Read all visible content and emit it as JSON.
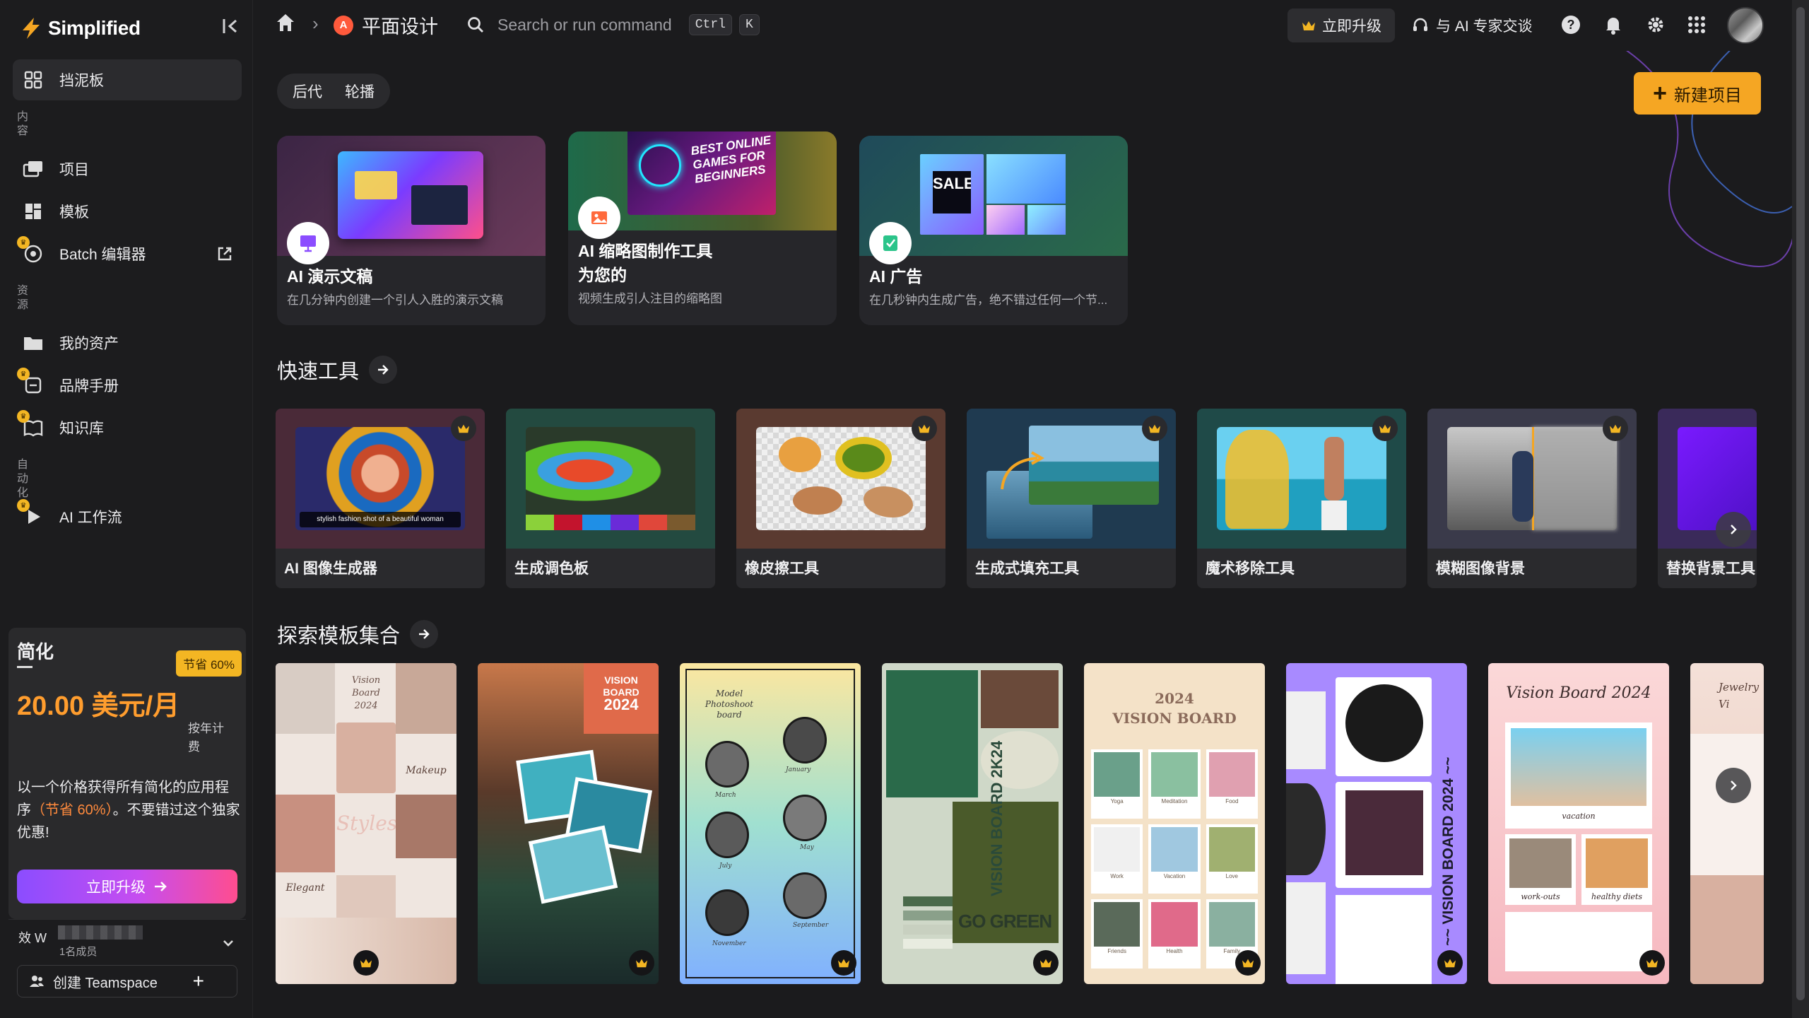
{
  "sidebar": {
    "logo_text": "Simplified",
    "nav": [
      {
        "label": "挡泥板",
        "icon": "dashboard-icon"
      },
      {
        "label": "项目",
        "icon": "projects-icon"
      },
      {
        "label": "模板",
        "icon": "templates-icon"
      },
      {
        "label": "Batch 编辑器",
        "icon": "batch-editor-icon"
      },
      {
        "label": "我的资产",
        "icon": "folder-icon"
      },
      {
        "label": "品牌手册",
        "icon": "brand-kit-icon"
      },
      {
        "label": "知识库",
        "icon": "knowledge-base-icon"
      },
      {
        "label": "AI 工作流",
        "icon": "ai-workflow-icon"
      }
    ],
    "sections": {
      "content": "内容",
      "assets": "资源",
      "automation": "自动化"
    },
    "promo": {
      "title": "简化",
      "badge": "节省 60%",
      "price": "20.00 美元/月",
      "billing": "按年计费",
      "desc_a": "以一个价格获得所有简化的应用程序",
      "desc_hl": "（节省 60%）",
      "desc_b": "。不要错过这个独家优惠!",
      "button": "立即升级"
    },
    "team": {
      "prefix": "效 W",
      "members": "1名成员",
      "create": "创建 Teamspace"
    }
  },
  "topbar": {
    "app_title": "平面设计",
    "search_placeholder": "Search or run command",
    "kbd1": "Ctrl",
    "kbd2": "K",
    "upgrade": "立即升级",
    "ai_expert": "与 AI 专家交谈"
  },
  "main": {
    "tabs": [
      "后代",
      "轮播"
    ],
    "new_project": "新建项目",
    "featured": [
      {
        "title": "AI 演示文稿",
        "sub": "在几分钟内创建一个引人入胜的演示文稿"
      },
      {
        "title": "AI 缩略图制作工具为您的",
        "sub": "视频生成引人注目的缩略图"
      },
      {
        "title": "AI 广告",
        "sub": "在几秒钟内生成广告，绝不错过任何一个节..."
      }
    ],
    "featured_art": {
      "games_banner": "BEST ONLINE GAMES FOR BEGINNERS",
      "sale": "SALE"
    },
    "quick_tools_title": "快速工具",
    "tools": [
      "AI 图像生成器",
      "生成调色板",
      "橡皮擦工具",
      "生成式填充工具",
      "魔术移除工具",
      "模糊图像背景",
      "替换背景工具"
    ],
    "tool_caption": "stylish fashion shot of a beautiful woman",
    "palette_colors": [
      "#8bd13a",
      "#c3142d",
      "#1f8fe6",
      "#6a2bd8",
      "#e0473a",
      "#7a5a2e"
    ],
    "templates_title": "探索模板集合",
    "templates": [
      {
        "lines": [
          "Vision Board",
          "2024"
        ],
        "sub": [
          "Styles",
          "Makeup",
          "Elegant"
        ]
      },
      {
        "lines": [
          "VISION",
          "BOARD",
          "2024"
        ]
      },
      {
        "lines": [
          "Model",
          "Photoshoot",
          "board"
        ],
        "sub": [
          "January",
          "March",
          "May",
          "July",
          "September",
          "November"
        ]
      },
      {
        "lines": [
          "GO GREEN",
          "VISION BOARD 2K24"
        ]
      },
      {
        "lines": [
          "2024",
          "VISION BOARD"
        ],
        "sub": [
          "Yoga",
          "Meditation",
          "Food",
          "Work",
          "Vacation",
          "Love",
          "Friends",
          "Health",
          "Family"
        ]
      },
      {
        "lines": [
          "~~ VISION BOARD 2024 ~~"
        ]
      },
      {
        "lines": [
          "Vision Board 2024"
        ],
        "sub": [
          "vacation",
          "work-outs",
          "healthy diets"
        ]
      },
      {
        "lines": [
          "Jewelry",
          "Vi"
        ]
      }
    ]
  },
  "colors": {
    "accent": "#f5a623",
    "orange_text": "#ff9d2e",
    "bg": "#1b1b1d"
  }
}
